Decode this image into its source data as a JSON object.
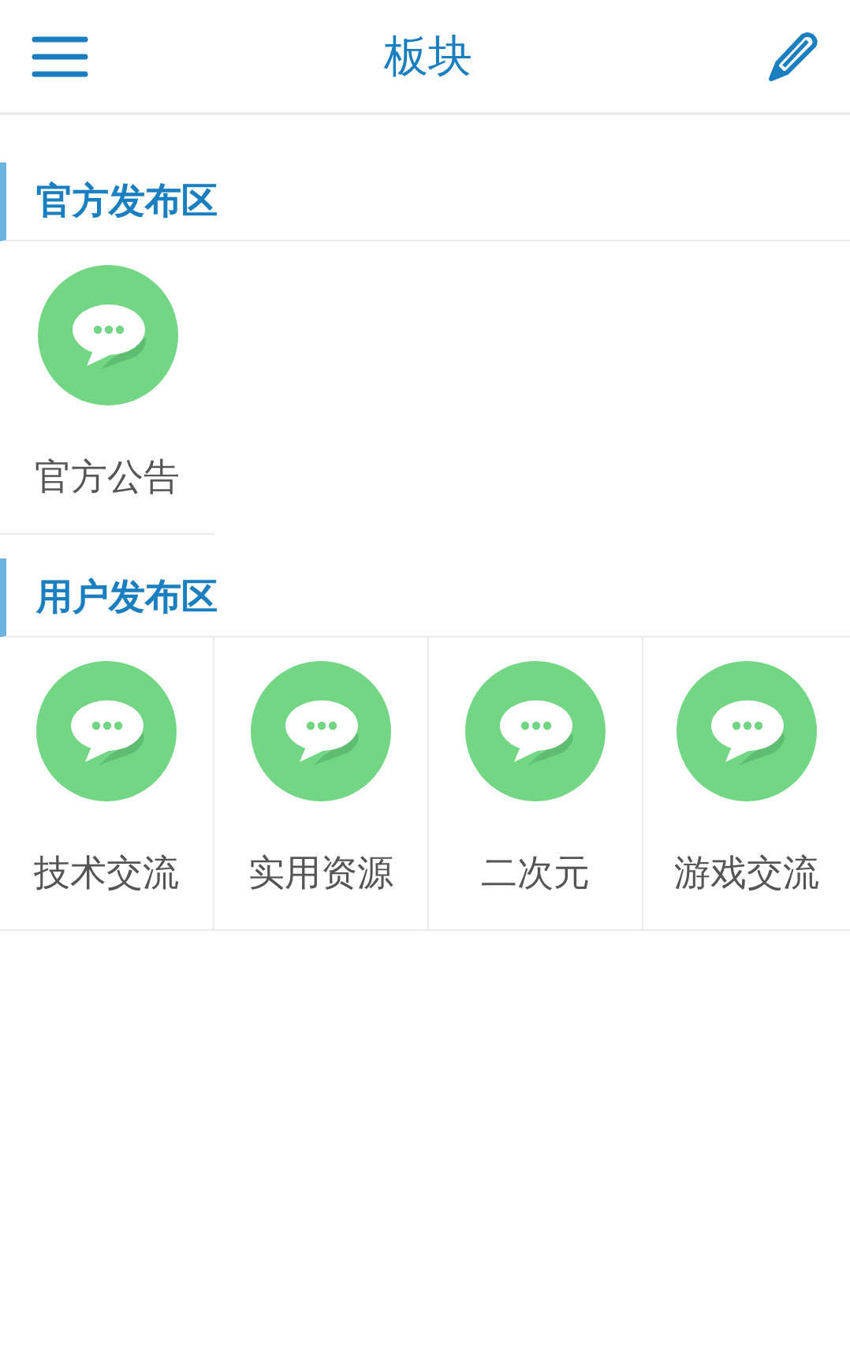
{
  "header": {
    "title": "板块"
  },
  "sections": [
    {
      "title": "官方发布区",
      "boards": [
        {
          "name": "官方公告"
        }
      ]
    },
    {
      "title": "用户发布区",
      "boards": [
        {
          "name": "技术交流"
        },
        {
          "name": "实用资源"
        },
        {
          "name": "二次元"
        },
        {
          "name": "游戏交流"
        }
      ]
    }
  ]
}
